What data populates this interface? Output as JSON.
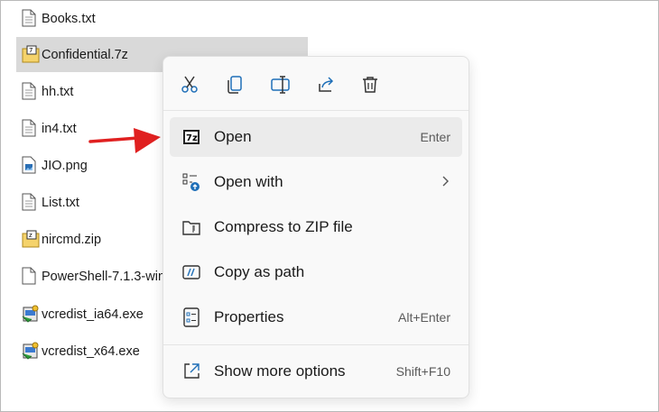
{
  "files": [
    {
      "name": "Books.txt",
      "icon": "text-file-icon",
      "selected": false
    },
    {
      "name": "Confidential.7z",
      "icon": "archive-7z-icon",
      "selected": true
    },
    {
      "name": "hh.txt",
      "icon": "text-file-icon",
      "selected": false
    },
    {
      "name": "in4.txt",
      "icon": "text-file-icon",
      "selected": false
    },
    {
      "name": "JIO.png",
      "icon": "image-file-icon",
      "selected": false
    },
    {
      "name": "List.txt",
      "icon": "text-file-icon",
      "selected": false
    },
    {
      "name": "nircmd.zip",
      "icon": "zip-file-icon",
      "selected": false
    },
    {
      "name": "PowerShell-7.1.3-win",
      "icon": "installer-file-icon",
      "selected": false
    },
    {
      "name": "vcredist_ia64.exe",
      "icon": "exe-installer-icon",
      "selected": false
    },
    {
      "name": "vcredist_x64.exe",
      "icon": "exe-installer-icon",
      "selected": false
    }
  ],
  "context_menu": {
    "toolbar": [
      {
        "name": "cut-icon"
      },
      {
        "name": "copy-icon"
      },
      {
        "name": "rename-icon"
      },
      {
        "name": "share-icon"
      },
      {
        "name": "delete-icon"
      }
    ],
    "items": [
      {
        "label": "Open",
        "accel": "Enter",
        "icon": "7zip-icon",
        "highlight": true
      },
      {
        "label": "Open with",
        "accel": "",
        "icon": "open-with-icon",
        "submenu": true
      },
      {
        "label": "Compress to ZIP file",
        "accel": "",
        "icon": "zip-folder-icon"
      },
      {
        "label": "Copy as path",
        "accel": "",
        "icon": "copy-path-icon"
      },
      {
        "label": "Properties",
        "accel": "Alt+Enter",
        "icon": "properties-icon"
      },
      {
        "label": "Show more options",
        "accel": "Shift+F10",
        "icon": "more-options-icon"
      }
    ]
  },
  "colors": {
    "selection": "#d9d9d9",
    "menu_bg": "#f9f9f9",
    "highlight": "#ebebeb",
    "annotation_arrow": "#e02020",
    "share_icon": "#1f6fb8"
  }
}
